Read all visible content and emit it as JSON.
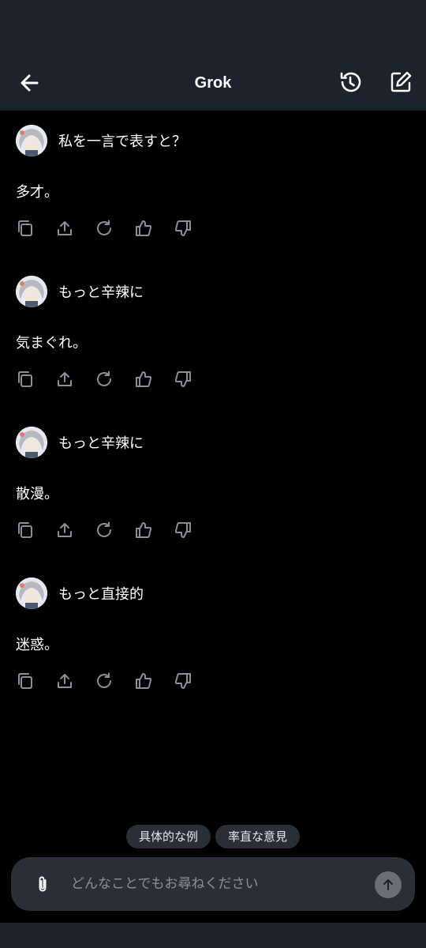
{
  "header": {
    "title": "Grok",
    "back_icon": "arrow-left-icon",
    "history_icon": "history-icon",
    "compose_icon": "new-chat-icon"
  },
  "conversation": [
    {
      "prompt": "私を一言で表すと？",
      "answer": "多才。"
    },
    {
      "prompt": "もっと辛辣に",
      "answer": "気まぐれ。"
    },
    {
      "prompt": "もっと辛辣に",
      "answer": "散漫。"
    },
    {
      "prompt": "もっと直接的",
      "answer": "迷惑。"
    }
  ],
  "action_icons": [
    "copy-icon",
    "share-icon",
    "regenerate-icon",
    "thumbs-up-icon",
    "thumbs-down-icon"
  ],
  "suggestions": [
    "具体的な例",
    "率直な意見"
  ],
  "composer": {
    "placeholder": "どんなことでもお尋ねください",
    "attach_icon": "paperclip-icon",
    "send_icon": "arrow-up-icon"
  },
  "colors": {
    "background": "#000000",
    "bar": "#1c232c",
    "surface": "#2a2f36",
    "icon": "#8b8f96"
  }
}
